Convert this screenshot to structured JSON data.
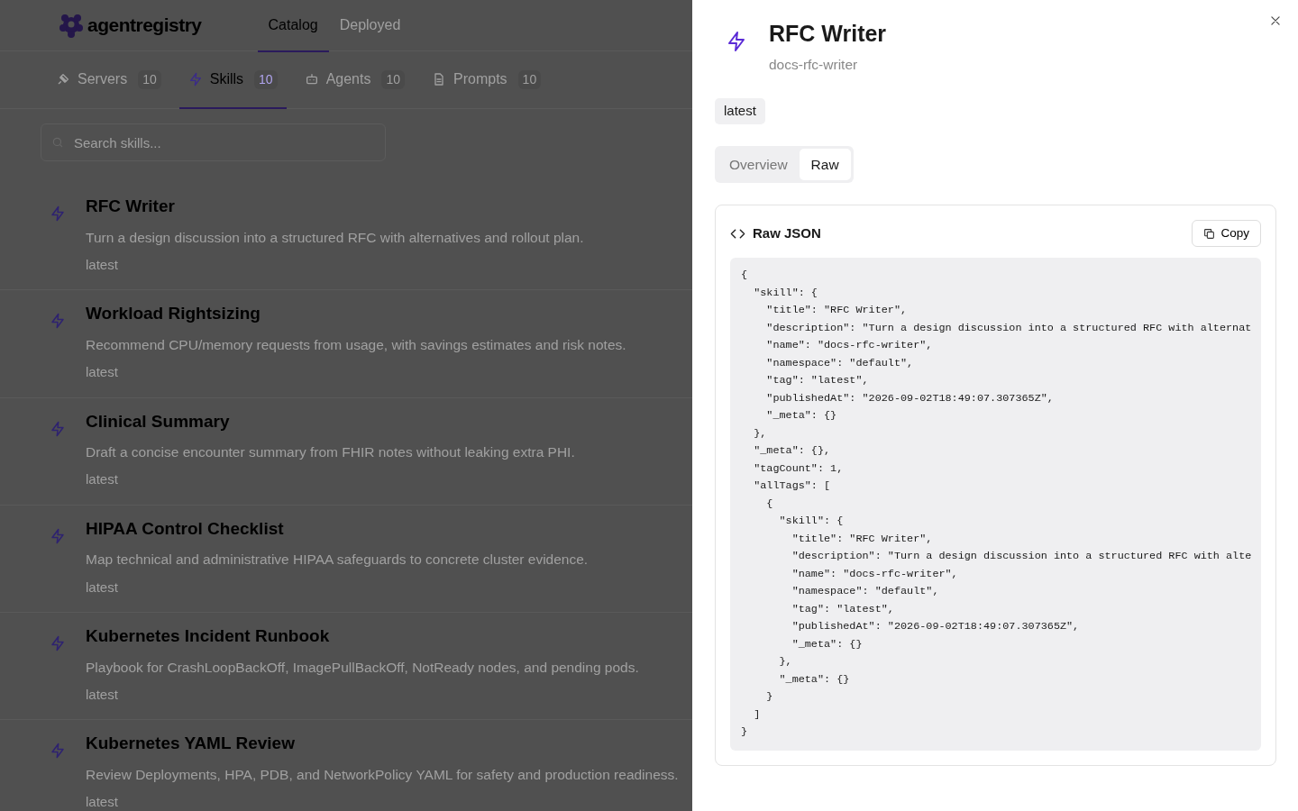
{
  "app": {
    "logo_text": "agentregistry",
    "nav": [
      {
        "label": "Catalog",
        "selected": true
      },
      {
        "label": "Deployed",
        "selected": false
      }
    ],
    "type_tabs": [
      {
        "label": "Servers",
        "count": "10",
        "selected": false
      },
      {
        "label": "Skills",
        "count": "10",
        "selected": true
      },
      {
        "label": "Agents",
        "count": "10",
        "selected": false
      },
      {
        "label": "Prompts",
        "count": "10",
        "selected": false
      }
    ],
    "search": {
      "placeholder": "Search skills..."
    },
    "skills": [
      {
        "title": "RFC Writer",
        "description": "Turn a design discussion into a structured RFC with alternatives and rollout plan.",
        "tag": "latest"
      },
      {
        "title": "Workload Rightsizing",
        "description": "Recommend CPU/memory requests from usage, with savings estimates and risk notes.",
        "tag": "latest"
      },
      {
        "title": "Clinical Summary",
        "description": "Draft a concise encounter summary from FHIR notes without leaking extra PHI.",
        "tag": "latest"
      },
      {
        "title": "HIPAA Control Checklist",
        "description": "Map technical and administrative HIPAA safeguards to concrete cluster evidence.",
        "tag": "latest"
      },
      {
        "title": "Kubernetes Incident Runbook",
        "description": "Playbook for CrashLoopBackOff, ImagePullBackOff, NotReady nodes, and pending pods.",
        "tag": "latest"
      },
      {
        "title": "Kubernetes YAML Review",
        "description": "Review Deployments, HPA, PDB, and NetworkPolicy YAML for safety and production readiness.",
        "tag": "latest"
      }
    ]
  },
  "drawer": {
    "title": "RFC Writer",
    "name": "docs-rfc-writer",
    "tag": "latest",
    "view_tabs": [
      {
        "label": "Overview",
        "selected": false
      },
      {
        "label": "Raw",
        "selected": true
      }
    ],
    "raw_panel": {
      "title": "Raw JSON",
      "copy_label": "Copy",
      "lines": [
        "{",
        "  \"skill\": {",
        "    \"title\": \"RFC Writer\",",
        "    \"description\": \"Turn a design discussion into a structured RFC with alternat",
        "    \"name\": \"docs-rfc-writer\",",
        "    \"namespace\": \"default\",",
        "    \"tag\": \"latest\",",
        "    \"publishedAt\": \"2026-09-02T18:49:07.307365Z\",",
        "    \"_meta\": {}",
        "  },",
        "  \"_meta\": {},",
        "  \"tagCount\": 1,",
        "  \"allTags\": [",
        "    {",
        "      \"skill\": {",
        "        \"title\": \"RFC Writer\",",
        "        \"description\": \"Turn a design discussion into a structured RFC with alte",
        "        \"name\": \"docs-rfc-writer\",",
        "        \"namespace\": \"default\",",
        "        \"tag\": \"latest\",",
        "        \"publishedAt\": \"2026-09-02T18:49:07.307365Z\",",
        "        \"_meta\": {}",
        "      },",
        "      \"_meta\": {}",
        "    }",
        "  ]",
        "}"
      ]
    }
  }
}
